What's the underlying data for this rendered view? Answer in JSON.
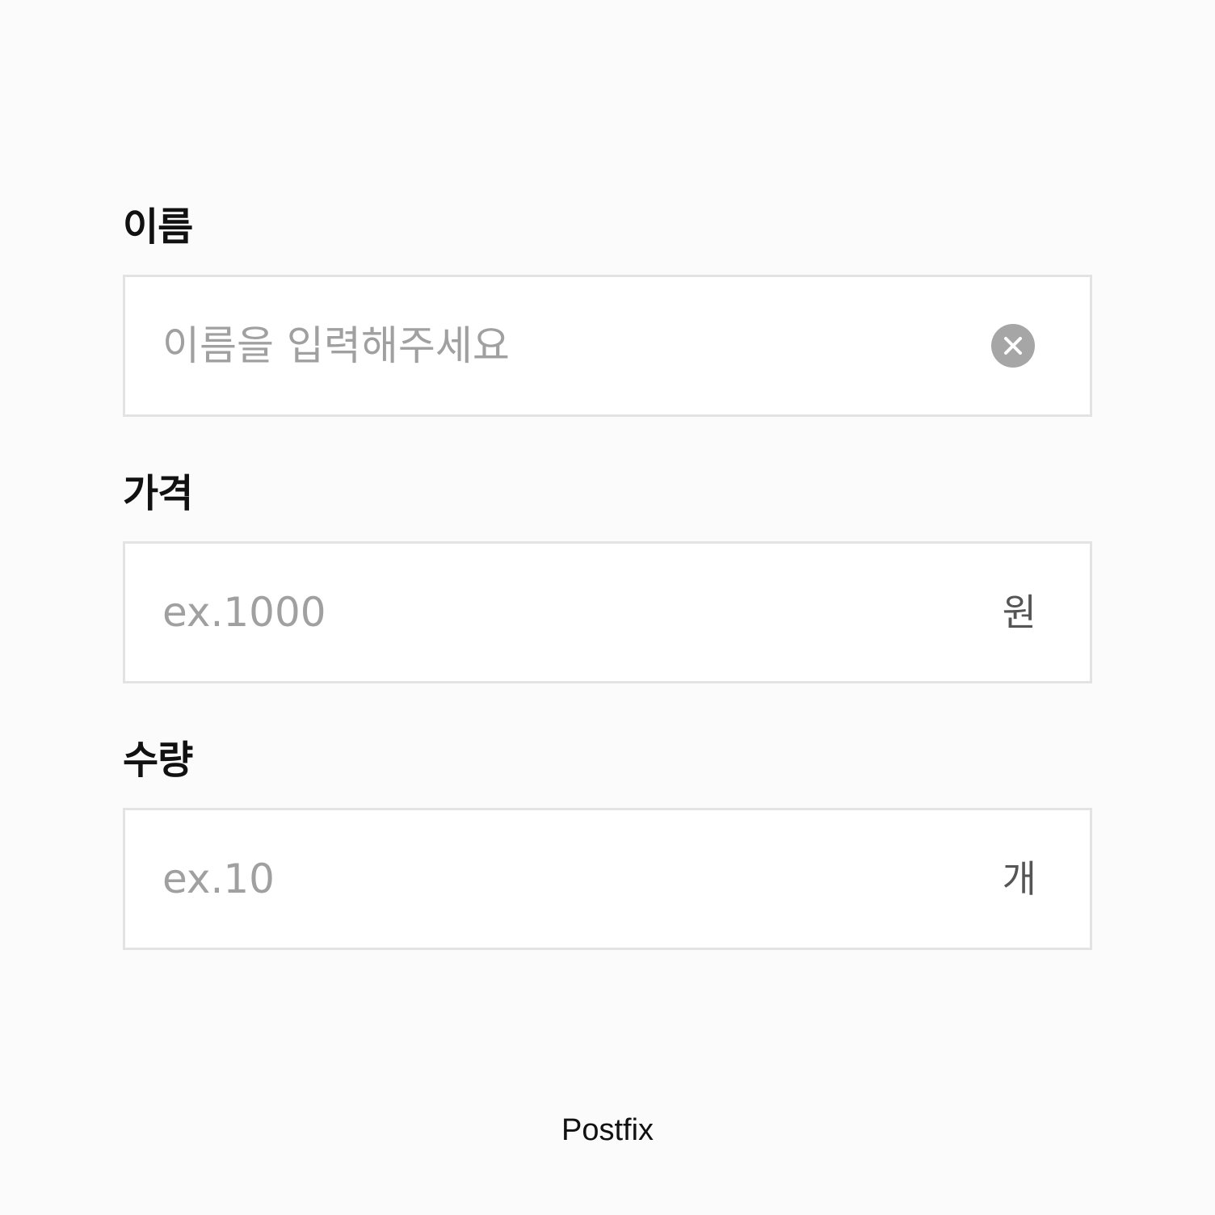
{
  "fields": [
    {
      "label": "이름",
      "placeholder": "이름을 입력해주세요",
      "value": "",
      "trailing": "clear-icon"
    },
    {
      "label": "가격",
      "placeholder": "ex.1000",
      "value": "",
      "suffix": "원"
    },
    {
      "label": "수량",
      "placeholder": "ex.10",
      "value": "",
      "suffix": "개"
    }
  ],
  "caption": "Postfix",
  "colors": {
    "background": "#fbfbfb",
    "border": "#e3e3e3",
    "placeholder": "#a0a0a0",
    "clear_icon": "#a6a6a6",
    "suffix_text": "#555555"
  }
}
